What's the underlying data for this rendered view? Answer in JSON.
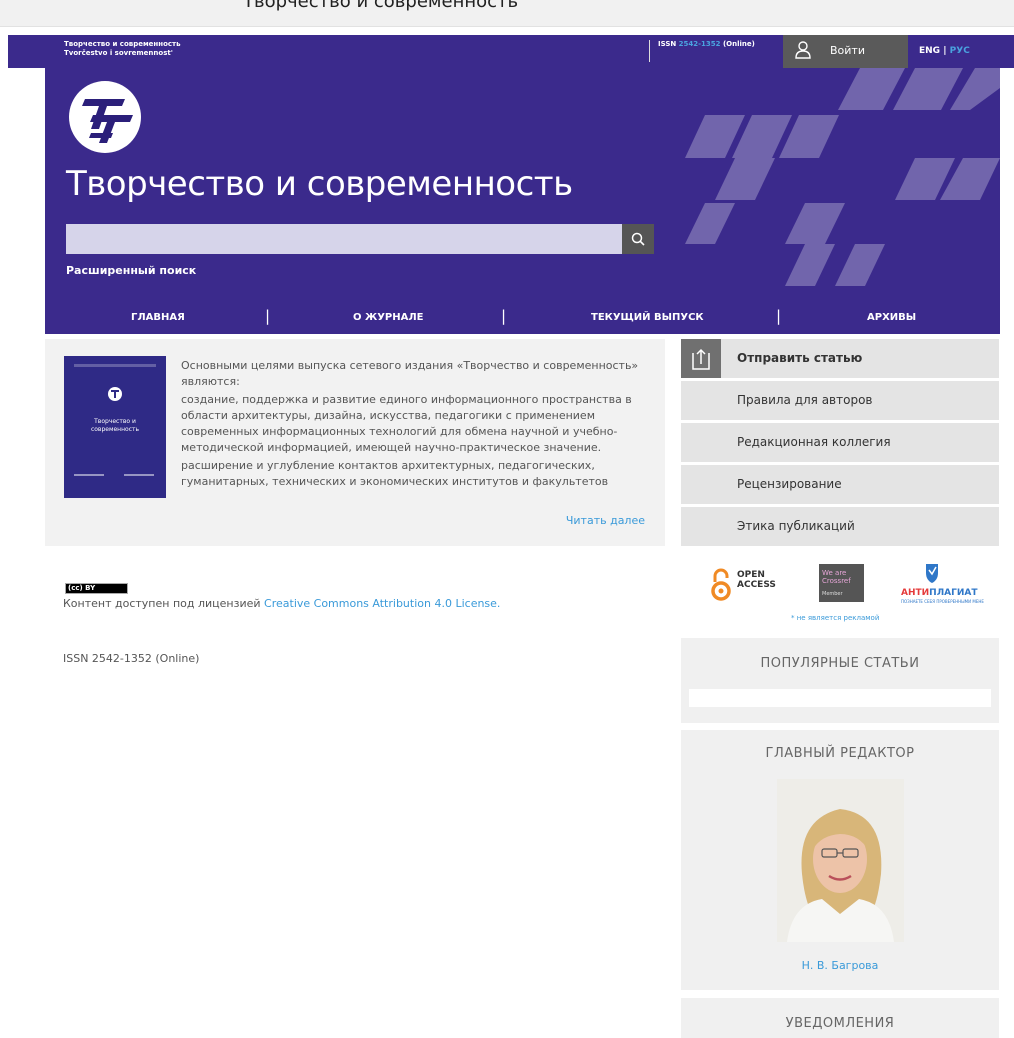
{
  "browser": {
    "page_title": "Творчество и современность"
  },
  "topbar": {
    "journal_name_ru": "Творчество и современность",
    "journal_name_translit": "Tvorčestvo i sovremennost'",
    "issn_prefix": "ISSN",
    "issn_number": "2542-1352",
    "issn_suffix": "(Online)",
    "login_label": "Войти",
    "lang_en": "ENG",
    "lang_sep": "|",
    "lang_ru": "РУС"
  },
  "header": {
    "site_title": "Творчество и современность",
    "search_placeholder": "",
    "advanced_search": "Расширенный поиск"
  },
  "nav": {
    "items": [
      {
        "label": "ГЛАВНАЯ"
      },
      {
        "label": "О ЖУРНАЛЕ"
      },
      {
        "label": "ТЕКУЩИЙ ВЫПУСК"
      },
      {
        "label": "АРХИВЫ"
      }
    ],
    "separator": "|"
  },
  "about": {
    "paragraphs": [
      "Основными целями выпуска сетевого издания «Творчество и современность» являются:",
      "создание, поддержка и развитие единого информационного пространства в области архитектуры, дизайна, искусства, педагогики с применением современных информационных технологий для обмена научной и учебно-методической информацией, имеющей научно-практическое значение.",
      "расширение и углубление контактов архитектурных, педагогических, гуманитарных, технических и экономических институтов и факультетов"
    ],
    "read_more": "Читать далее",
    "cover_title": "Творчество и современность"
  },
  "sidebar_menu": {
    "items": [
      {
        "label": "Отправить статью"
      },
      {
        "label": "Правила для авторов"
      },
      {
        "label": "Редакционная коллегия"
      },
      {
        "label": "Рецензирование"
      },
      {
        "label": "Этика публикаций"
      }
    ]
  },
  "license": {
    "badge": "(cc) BY",
    "prefix": "Контент доступен под лицензией",
    "link": "Creative Commons Attribution 4.0 License."
  },
  "footer": {
    "issn": "ISSN 2542-1352 (Online)"
  },
  "logos": {
    "oa_line1": "OPEN",
    "oa_line2": "ACCESS",
    "wao_line1": "We are",
    "wao_line2": "Crossref",
    "wao_line3": "Member",
    "anti_main_a": "АНТИ",
    "anti_main_b": "ПЛАГИАТ",
    "anti_sub": "ПОЗНАЕТЕ СЕБЯ ПРОВЕРЕННЫМИ МЕНЕ",
    "not_ad": "* не является рекламой"
  },
  "popular": {
    "title": "ПОПУЛЯРНЫЕ СТАТЬИ"
  },
  "editor": {
    "title": "ГЛАВНЫЙ РЕДАКТОР",
    "name": "Н. В. Багрова"
  },
  "notifications": {
    "title": "УВЕДОМЛЕНИЯ"
  },
  "colors": {
    "brand": "#3b2a8c",
    "link": "#3a9ad9",
    "menu_bg": "#e4e4e4"
  },
  "icons": {
    "search": "search-icon",
    "user": "user-icon",
    "upload": "upload-icon"
  }
}
